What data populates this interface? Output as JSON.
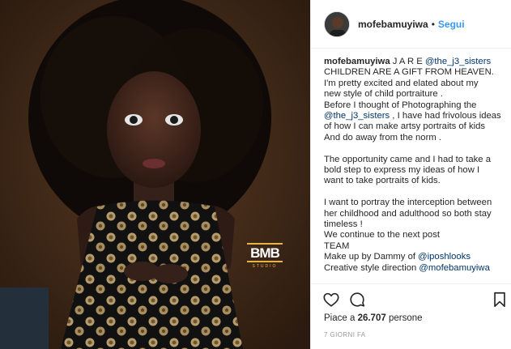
{
  "post": {
    "watermark": {
      "letters": "BMB",
      "studio": "STUDIO"
    }
  },
  "header": {
    "username": "mofebamuyiwa",
    "separator": "•",
    "follow_label": "Segui"
  },
  "caption": {
    "username": "mofebamuyiwa",
    "first_line_text": " J A R E ",
    "first_line_mention": "@the_j3_sisters",
    "lines": [
      "CHILDREN ARE A GIFT FROM HEAVEN.",
      "I'm pretty excited and elated about my",
      "new style of child portraiture .",
      "Before I thought of Photographing the"
    ],
    "mention_line_prefix": "",
    "mention_line_mention": "@the_j3_sisters",
    "mention_line_suffix": " , I have had frivolous ideas",
    "lines_after": [
      "of how I can make artsy portraits of kids",
      "And do away from the norm ."
    ],
    "paragraph2": [
      "The opportunity came and I had to take a",
      "bold step to express my ideas of how I",
      "want to take portraits of kids."
    ],
    "paragraph3": [
      "I want to portray the interception between",
      "her childhood and adulthood so both stay",
      "timeless !",
      "We continue to the next post",
      "TEAM"
    ],
    "makeup_prefix": "Make up by Dammy of ",
    "makeup_mention": "@iposhlooks",
    "creative_prefix": "Creative style direction ",
    "creative_mention": "@mofebamuyiwa"
  },
  "actions": {
    "like_icon": "heart-outline-icon",
    "comment_icon": "speech-bubble-icon",
    "save_icon": "bookmark-icon",
    "likes_prefix": "Piace a ",
    "likes_count": "26.707",
    "likes_suffix": " persone",
    "date": "7 GIORNI FA"
  },
  "colors": {
    "link": "#3897f0",
    "mention": "#003569",
    "watermark_gold": "#e8b247"
  }
}
